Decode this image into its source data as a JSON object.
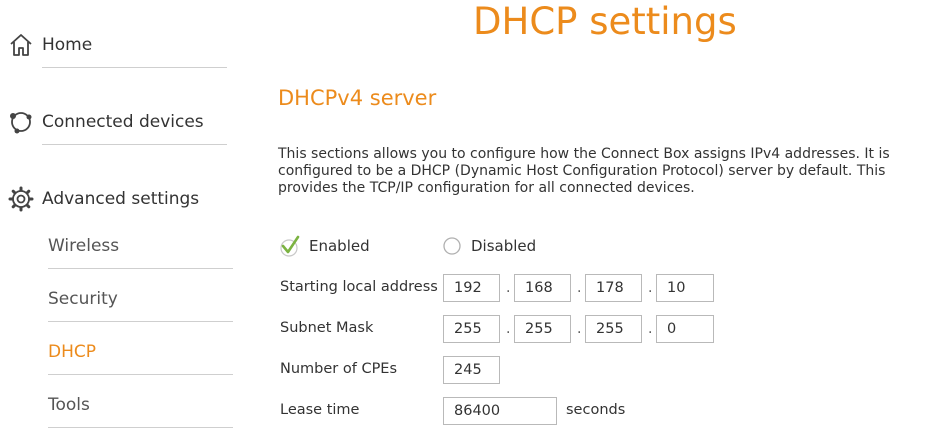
{
  "sidebar": {
    "home_label": "Home",
    "connected_label": "Connected devices",
    "advanced_label": "Advanced settings",
    "sub_items": [
      "Wireless",
      "Security",
      "DHCP",
      "Tools"
    ],
    "active_item": "DHCP"
  },
  "page": {
    "title": "DHCP settings",
    "section_title": "DHCPv4 server",
    "description": "This sections allows you to configure how the Connect Box assigns IPv4 addresses. It is configured to be a DHCP (Dynamic Host Configuration Protocol) server by default. This provides the TCP/IP configuration for all connected devices."
  },
  "mode": {
    "enabled_label": "Enabled",
    "disabled_label": "Disabled",
    "selected": "Enabled"
  },
  "fields": {
    "start_label": "Starting local address",
    "start_octets": [
      "192",
      "168",
      "178",
      "10"
    ],
    "mask_label": "Subnet Mask",
    "mask_octets": [
      "255",
      "255",
      "255",
      "0"
    ],
    "cpe_label": "Number of CPEs",
    "cpe_value": "245",
    "lease_label": "Lease time",
    "lease_value": "86400",
    "lease_unit": "seconds",
    "octet_separator": "."
  },
  "colors": {
    "accent": "#ec8b1c",
    "check": "#7cb342",
    "text": "#333333"
  }
}
